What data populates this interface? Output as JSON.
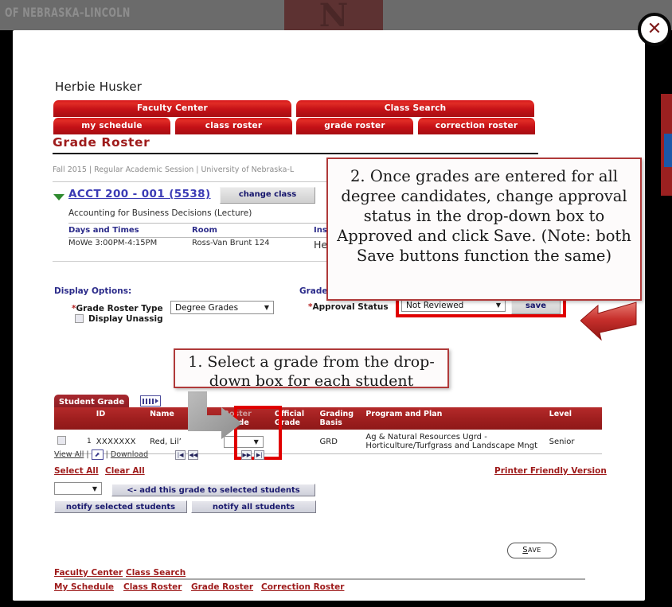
{
  "background": {
    "university_text": "OF NEBRASKA–LINCOLN",
    "logo_letter": "N"
  },
  "modal": {
    "close_icon": "close-icon"
  },
  "user": {
    "name": "Herbie Husker"
  },
  "tabs": {
    "level1": [
      {
        "label": "Faculty Center"
      },
      {
        "label": "Class Search"
      }
    ],
    "level2": [
      {
        "label": "my schedule"
      },
      {
        "label": "class roster"
      },
      {
        "label": "grade roster"
      },
      {
        "label": "correction roster"
      }
    ]
  },
  "page": {
    "title": "Grade Roster",
    "breadcrumb": "Fall 2015 | Regular Academic Session | University of Nebraska-L"
  },
  "class": {
    "expand_icon": "triangle-down-icon",
    "link": "ACCT 200 - 001 (5538)",
    "change_class_button": "change class",
    "description": "Accounting for Business Decisions (Lecture)",
    "meeting_headers": [
      "Days and Times",
      "Room",
      "Inst"
    ],
    "meeting_row": [
      "MoWe 3:00PM-4:15PM",
      "Ross-Van Brunt 124",
      "He"
    ]
  },
  "display_options": {
    "heading": "Display Options:",
    "grade_roster_type_label": "Grade Roster Type",
    "grade_roster_type_value": "Degree Grades",
    "display_unassigned_label": "Display Unassig",
    "checkbox_checked": false
  },
  "grade_roster_action": {
    "heading": "Grade Roster Action:",
    "approval_status_label": "Approval Status",
    "approval_status_value": "Not Reviewed",
    "save_button": "save"
  },
  "callouts": {
    "one": "1. Select a grade from the drop-down box for each student",
    "two": "2. Once grades are entered for all degree candidates, change approval status in the drop-down box to Approved and click Save. (Note: both Save buttons function the same)"
  },
  "student_grade": {
    "tab_label": "Student Grade",
    "grid_icon": "grid-view-icon",
    "columns": [
      "",
      "",
      "ID",
      "Name",
      "Roster Grade",
      "Official Grade",
      "Grading Basis",
      "Program and Plan",
      "Level"
    ],
    "roster_grade_header_faded": "Roster",
    "roster_grade_header": "Grade",
    "official_grade_header_1": "Official",
    "official_grade_header_2": "Grade",
    "grading_basis_header_1": "Grading",
    "grading_basis_header_2": "Basis",
    "rows": [
      {
        "checkbox": false,
        "num": "1",
        "id": "XXXXXXX",
        "name": "Red, Lil’",
        "roster_grade": "",
        "official_grade": "",
        "grading_basis": "GRD",
        "program_line1": "Ag & Natural Resources Ugrd -",
        "program_line2": "Horticulture/Turfgrass and Landscape Mngt",
        "level": "Senior"
      }
    ]
  },
  "pager": {
    "view_all": "View All",
    "popout_icon": "popout-icon",
    "download": "Download",
    "first_icon": "first-page-icon",
    "prev_icon": "prev-page-icon",
    "next_icon": "next-page-icon",
    "last_icon": "last-page-icon",
    "separator": "|"
  },
  "actions": {
    "select_all": "Select All",
    "clear_all": "Clear All",
    "printer_friendly": "Printer Friendly Version",
    "bulk_grade_value": "",
    "add_grade_button": "<- add this grade to selected students",
    "notify_selected": "notify selected students",
    "notify_all": "notify all students",
    "save_button": "SAVE",
    "save_accesskey": "S",
    "save_rest": "AVE"
  },
  "footer": {
    "row1": [
      "Faculty Center",
      "Class Search"
    ],
    "row2": [
      "My Schedule",
      "Class Roster",
      "Grade Roster",
      "Correction Roster"
    ]
  },
  "annotations": {
    "red_arrow": "red-arrow-icon",
    "grey_arrow": "grey-arrow-icon"
  },
  "colors": {
    "brand_red": "#9e1b1b",
    "tab_red": "#c41117",
    "highlight_red": "#e00000",
    "link_blue": "#3b3bb5",
    "header_blue": "#2b2b8a"
  }
}
